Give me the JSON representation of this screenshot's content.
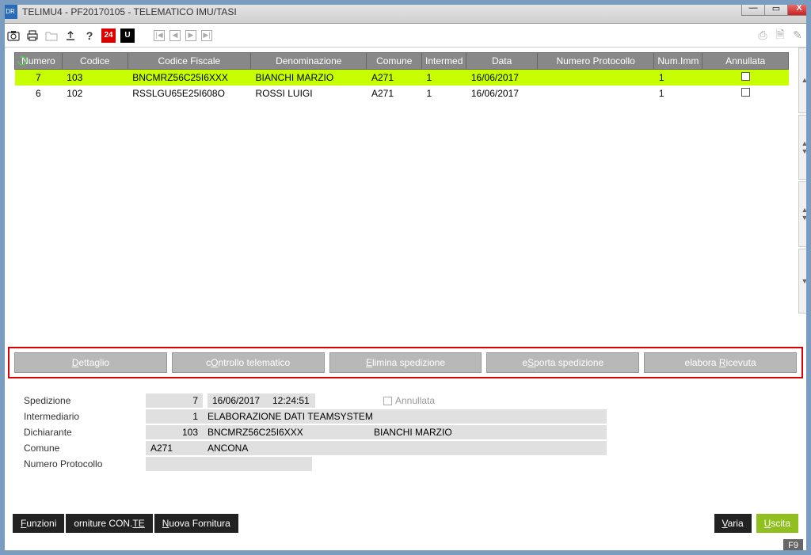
{
  "window": {
    "title": "TELIMU4 - PF20170105 - TELEMATICO IMU/TASI"
  },
  "table": {
    "headers": {
      "numero": "Numero",
      "codice": "Codice",
      "codice_fiscale": "Codice Fiscale",
      "denominazione": "Denominazione",
      "comune": "Comune",
      "intermed": "Intermed",
      "data": "Data",
      "numero_protocollo": "Numero Protocollo",
      "num_imm": "Num.Imm",
      "annullata": "Annullata"
    },
    "rows": [
      {
        "numero": "7",
        "codice": "103",
        "codice_fiscale": "BNCMRZ56C25I6XXX",
        "denominazione": "BIANCHI MARZIO",
        "comune": "A271",
        "intermed": "1",
        "data": "16/06/2017",
        "numero_protocollo": "",
        "num_imm": "1",
        "selected": true
      },
      {
        "numero": "6",
        "codice": "102",
        "codice_fiscale": "RSSLGU65E25I608O",
        "denominazione": "ROSSI LUIGI",
        "comune": "A271",
        "intermed": "1",
        "data": "16/06/2017",
        "numero_protocollo": "",
        "num_imm": "1",
        "selected": false
      }
    ]
  },
  "actions": {
    "dettaglio": "Dettaglio",
    "controllo": "cOntrollo telematico",
    "elimina": "Elimina spedizione",
    "esporta": "eSporta spedizione",
    "ricevuta": "elabora Ricevuta"
  },
  "detail": {
    "labels": {
      "spedizione": "Spedizione",
      "intermediario": "Intermediario",
      "dichiarante": "Dichiarante",
      "comune": "Comune",
      "numero_protocollo": "Numero Protocollo",
      "annullata": "Annullata"
    },
    "spedizione_num": "7",
    "spedizione_data": "16/06/2017",
    "spedizione_ora": "12:24:51",
    "intermediario_num": "1",
    "intermediario_desc": "ELABORAZIONE DATI TEAMSYSTEM",
    "dichiarante_num": "103",
    "dichiarante_cf": "BNCMRZ56C25I6XXX",
    "dichiarante_nome": "BIANCHI MARZIO",
    "comune_cod": "A271",
    "comune_desc": "ANCONA",
    "numero_protocollo": ""
  },
  "bottom": {
    "funzioni": "Funzioni",
    "forniture": "orniture CON.TE",
    "nuova": "Nuova Fornitura",
    "varia": "Varia",
    "uscita": "Uscita"
  },
  "status": {
    "f9": "F9"
  },
  "toolbar": {
    "brand24": "24",
    "brandU": "U"
  }
}
